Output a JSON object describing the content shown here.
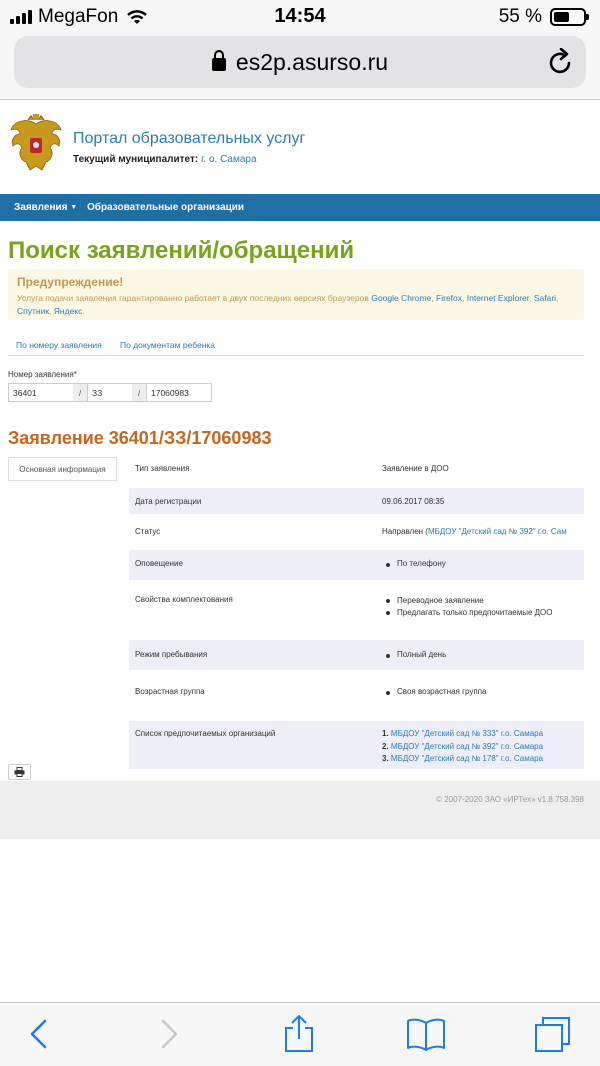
{
  "status_bar": {
    "carrier": "MegaFon",
    "time": "14:54",
    "battery": "55 %",
    "battery_level": 0.55
  },
  "browser": {
    "url": "es2p.asurso.ru"
  },
  "header": {
    "portal_title": "Портал образовательных услуг",
    "municipality_label": "Текущий муниципалитет:",
    "municipality_value": "г. о. Самара"
  },
  "nav": {
    "items": [
      {
        "label": "Заявления"
      },
      {
        "label": "Образовательные организации"
      }
    ]
  },
  "page": {
    "title": "Поиск заявлений/обращений",
    "alert": {
      "title": "Предупреждение!",
      "text": "Услуга подачи заявления гарантированно работает в двух последних версиях браузеров",
      "browsers": [
        "Google Chrome",
        "Firefox",
        "Internet Explorer",
        "Safari",
        "Спутник",
        "Яндекс"
      ]
    },
    "tabs": [
      {
        "label": "По номеру заявления"
      },
      {
        "label": "По документам ребенка"
      }
    ],
    "number_form": {
      "label": "Номер заявления",
      "required_mark": "*",
      "part1": "36401",
      "part2": "ЗЗ",
      "part3": "17060983",
      "separator": "/"
    }
  },
  "application": {
    "title": "Заявление 36401/ЗЗ/17060983",
    "side_tab": "Основная информация",
    "rows": {
      "type": {
        "key": "Тип заявления",
        "value": "Заявление в ДОО"
      },
      "reg_date": {
        "key": "Дата регистрации",
        "value": "09.06.2017 08:35"
      },
      "status": {
        "key": "Статус",
        "value": "Направлен (",
        "link": "МБДОУ \"Детский сад № 392\" г.о. Сам"
      },
      "notify": {
        "key": "Оповещение",
        "items": [
          "По телефону"
        ]
      },
      "props": {
        "key": "Свойства комплектования",
        "items": [
          "Переводное заявление",
          "Предлагать только предпочитаемые ДОО"
        ]
      },
      "mode": {
        "key": "Режим пребывания",
        "items": [
          "Полный день"
        ]
      },
      "age": {
        "key": "Возрастная группа",
        "items": [
          "Своя возрастная группа"
        ]
      },
      "orgs": {
        "key": "Список предпочитаемых организаций",
        "items": [
          {
            "n": "1.",
            "name": "МБДОУ \"Детский сад № 333\" г.о. Самара"
          },
          {
            "n": "2.",
            "name": "МБДОУ \"Детский сад № 392\" г.о. Самара"
          },
          {
            "n": "3.",
            "name": "МБДОУ \"Детский сад № 178\" г.о. Самара"
          }
        ]
      }
    }
  },
  "footer": {
    "copyright": "© 2007-2020 ЗАО «ИРТех» v1.8.758.398"
  },
  "icons": [
    "signal-icon",
    "wifi-icon",
    "battery-icon",
    "lock-icon",
    "reload-icon",
    "emblem-icon",
    "print-icon",
    "back-icon",
    "forward-icon",
    "share-icon",
    "bookmarks-icon",
    "tabs-icon"
  ],
  "colors": {
    "nav_bg": "#1d6fa5",
    "title_green": "#7aa31a",
    "title_orange": "#c8661d",
    "link": "#2a7db5",
    "alert_bg": "#fcf8e3",
    "ios_blue": "#1a7cf5"
  }
}
